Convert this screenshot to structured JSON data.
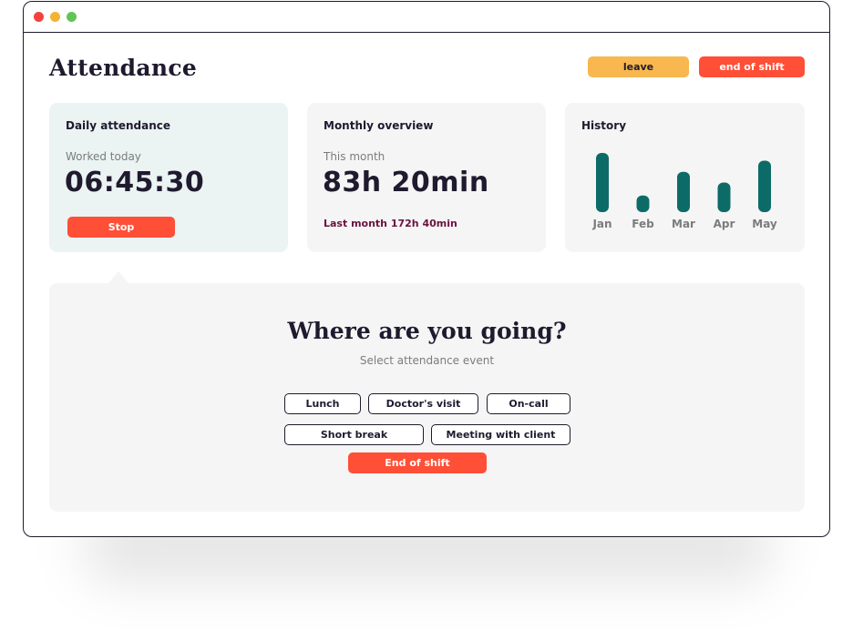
{
  "window": {
    "controls": [
      "close",
      "minimize",
      "maximize"
    ]
  },
  "header": {
    "title": "Attendance",
    "leave_label": "leave",
    "end_shift_label": "end of shift"
  },
  "daily": {
    "title": "Daily attendance",
    "subtitle": "Worked today",
    "time": "06:45:30",
    "stop_label": "Stop"
  },
  "monthly": {
    "title": "Monthly overview",
    "subtitle": "This month",
    "total": "83h 20min",
    "last_month": "Last month 172h 40min"
  },
  "history": {
    "title": "History",
    "bar_color": "#0d6b67",
    "months": [
      "Jan",
      "Feb",
      "Mar",
      "Apr",
      "May"
    ],
    "values": [
      1.0,
      0.28,
      0.68,
      0.5,
      0.87
    ]
  },
  "panel": {
    "heading": "Where are you going?",
    "subtitle": "Select attendance event",
    "events": [
      "Lunch",
      "Doctor's visit",
      "On-call",
      "Short break",
      "Meeting with client"
    ],
    "end_shift_label": "End of shift"
  },
  "colors": {
    "accent_red": "#ff4f36",
    "accent_yellow": "#f8b74f",
    "teal": "#0d6b67",
    "text_dark": "#1f1a2e",
    "last_month_text": "#6a1240"
  }
}
